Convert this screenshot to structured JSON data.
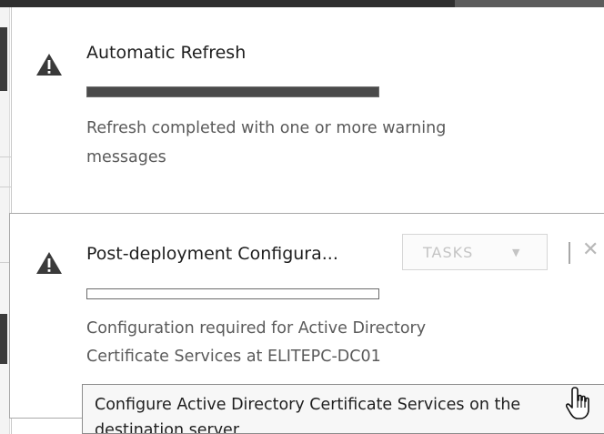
{
  "notifications": [
    {
      "title": "Automatic Refresh",
      "progress": 1.0,
      "description_line1": "Refresh completed with one or more warning",
      "description_line2": "messages",
      "icon": "warning-icon"
    },
    {
      "title": "Post-deployment Configura...",
      "progress": 0.0,
      "description_line1": "Configuration required for Active Directory",
      "description_line2": "Certificate Services at ELITEPC-DC01",
      "icon": "warning-icon",
      "tasks_label": "TASKS",
      "action_link_line1": "Configure Active Directory Certificate Services on the",
      "action_link_line2": "destination server"
    }
  ],
  "colors": {
    "progress_fill": "#4a4a4a",
    "warning_icon": "#3a3a3a"
  }
}
